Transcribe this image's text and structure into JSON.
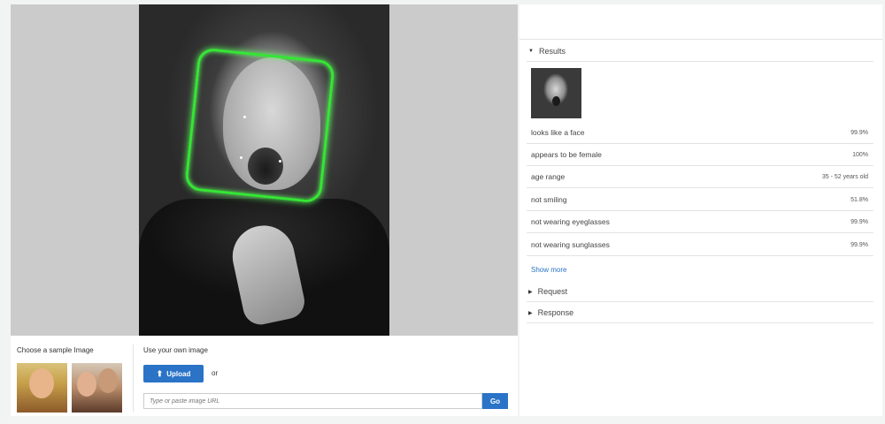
{
  "sample": {
    "label": "Choose a sample Image"
  },
  "own": {
    "label": "Use your own image",
    "upload_label": "Upload",
    "upload_icon": "upload-icon",
    "or_text": "or",
    "url_placeholder": "Type or paste image URL",
    "go_label": "Go"
  },
  "results": {
    "title": "Results",
    "rows": [
      {
        "label": "looks like a face",
        "value": "99.9%"
      },
      {
        "label": "appears to be female",
        "value": "100%"
      },
      {
        "label": "age range",
        "value": "35 - 52 years old"
      },
      {
        "label": "not smiling",
        "value": "51.8%"
      },
      {
        "label": "not wearing eyeglasses",
        "value": "99.9%"
      },
      {
        "label": "not wearing sunglasses",
        "value": "99.9%"
      }
    ],
    "show_more": "Show more"
  },
  "request": {
    "title": "Request"
  },
  "response": {
    "title": "Response"
  },
  "colors": {
    "accent": "#2a73c7",
    "face_box": "#35e635"
  }
}
